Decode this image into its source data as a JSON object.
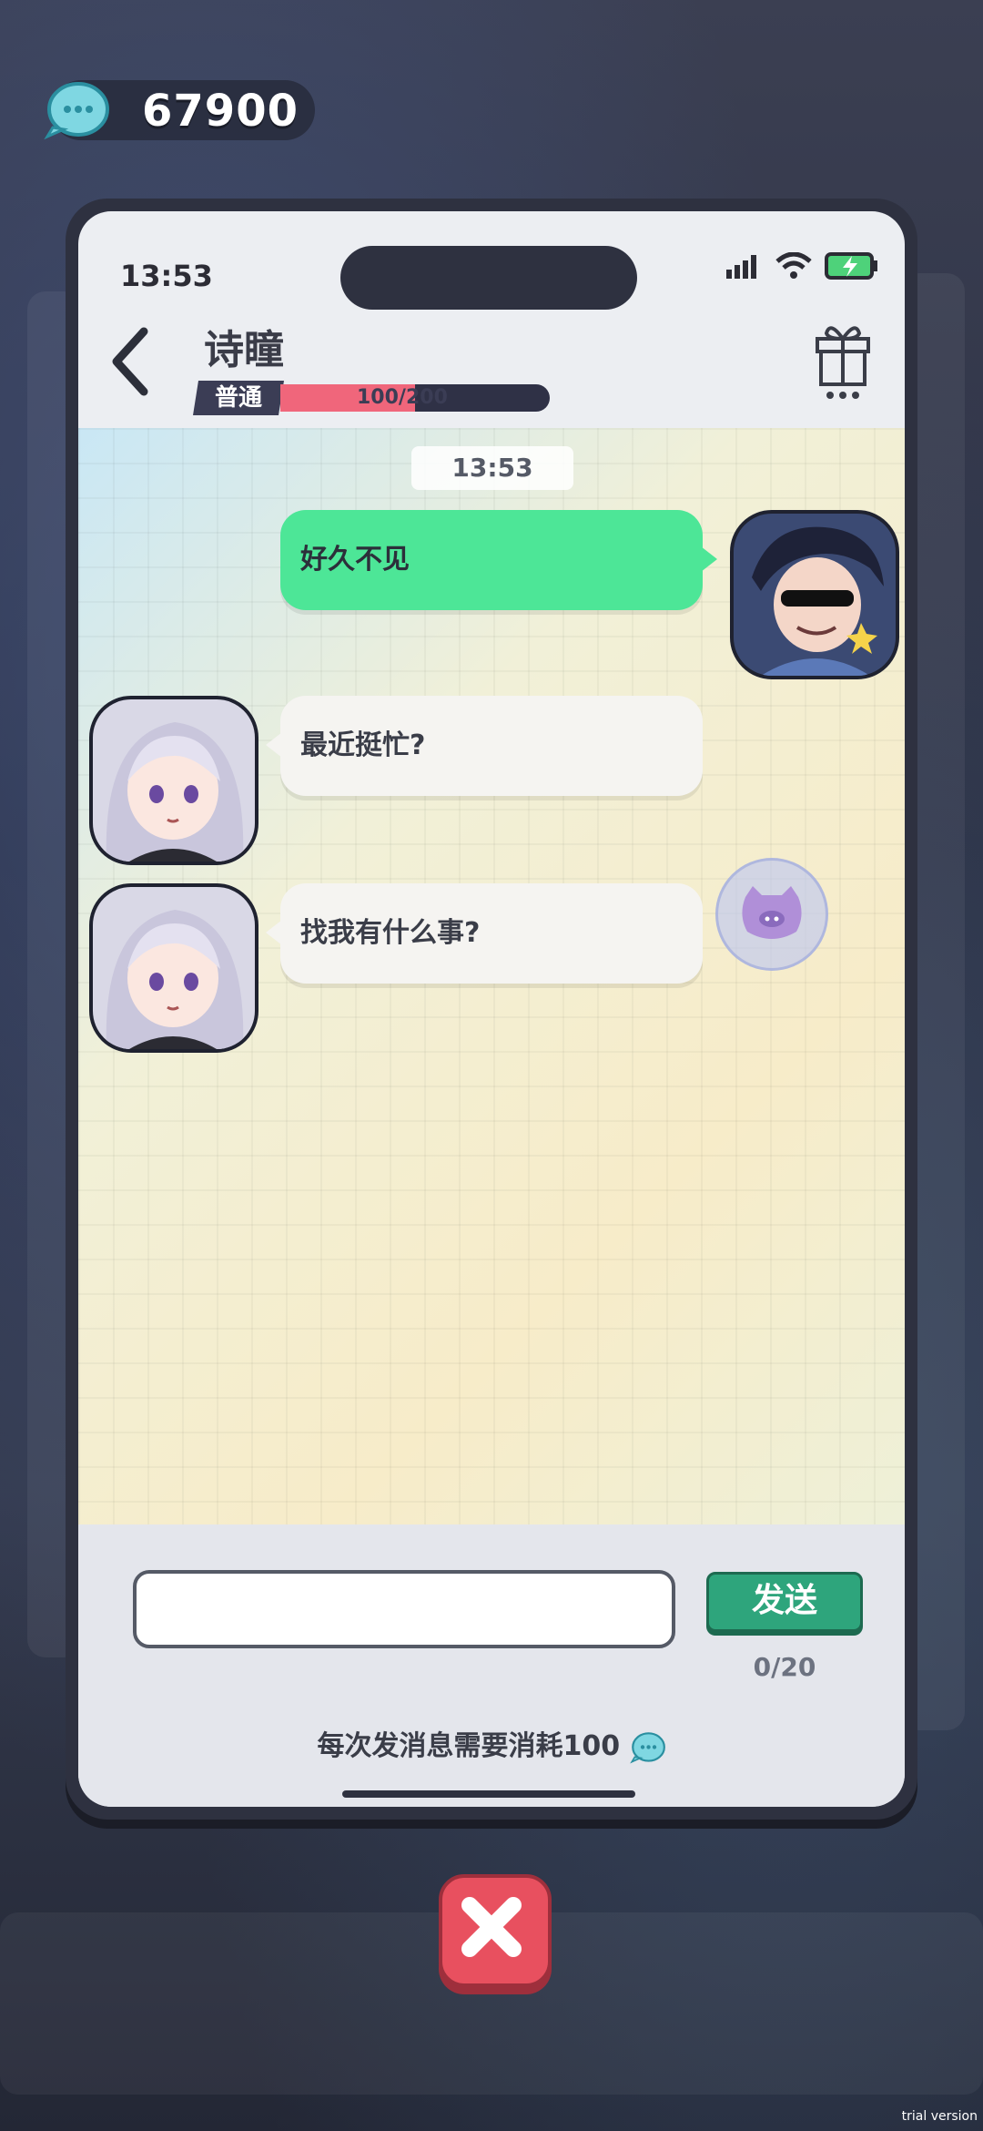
{
  "currency": {
    "amount": "67900",
    "icon": "chat-bubble-coin-icon"
  },
  "phone": {
    "status_time": "13:53",
    "contact": {
      "name": "诗瞳",
      "rank": "普通",
      "affinity_text": "100/200",
      "affinity_fraction": 0.5
    },
    "chat": {
      "timestamp": "13:53",
      "messages": [
        {
          "side": "out",
          "text": "好久不见"
        },
        {
          "side": "in",
          "text": "最近挺忙?"
        },
        {
          "side": "in",
          "text": "找我有什么事?"
        }
      ]
    },
    "input": {
      "value": "",
      "placeholder": ""
    },
    "send_label": "发送",
    "char_count": "0/20",
    "cost_note": "每次发消息需要消耗100"
  },
  "watermark": "trial version",
  "colors": {
    "outgoing": "#4de697",
    "send": "#2ea57c",
    "close": "#e8505f",
    "affinity": "#f0667b"
  }
}
